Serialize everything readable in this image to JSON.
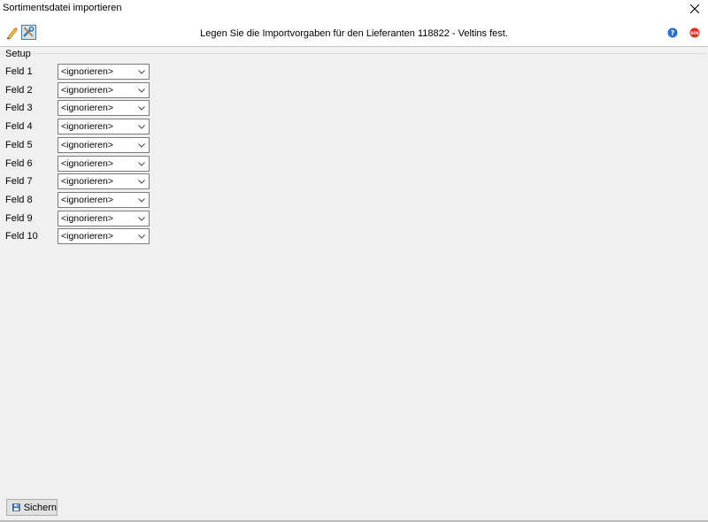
{
  "window": {
    "title": "Sortimentsdatei importieren"
  },
  "header": {
    "message": "Legen Sie die Importvorgaben für den Lieferanten 118822 - Veltins fest.",
    "icons": [
      "edit-icon",
      "settings-icon",
      "help-icon",
      "sos-icon"
    ]
  },
  "setup": {
    "legend": "Setup",
    "fields": [
      {
        "label": "Feld 1",
        "value": "<ignorieren>"
      },
      {
        "label": "Feld 2",
        "value": "<ignorieren>"
      },
      {
        "label": "Feld 3",
        "value": "<ignorieren>"
      },
      {
        "label": "Feld 4",
        "value": "<ignorieren>"
      },
      {
        "label": "Feld 5",
        "value": "<ignorieren>"
      },
      {
        "label": "Feld 6",
        "value": "<ignorieren>"
      },
      {
        "label": "Feld 7",
        "value": "<ignorieren>"
      },
      {
        "label": "Feld 8",
        "value": "<ignorieren>"
      },
      {
        "label": "Feld 9",
        "value": "<ignorieren>"
      },
      {
        "label": "Feld 10",
        "value": "<ignorieren>"
      }
    ]
  },
  "footer": {
    "save_label": "Sichern"
  },
  "colors": {
    "background": "#f0f0f0",
    "header_bg": "#ffffff",
    "help_blue": "#2a6fc9",
    "sos_red": "#d9321f"
  }
}
